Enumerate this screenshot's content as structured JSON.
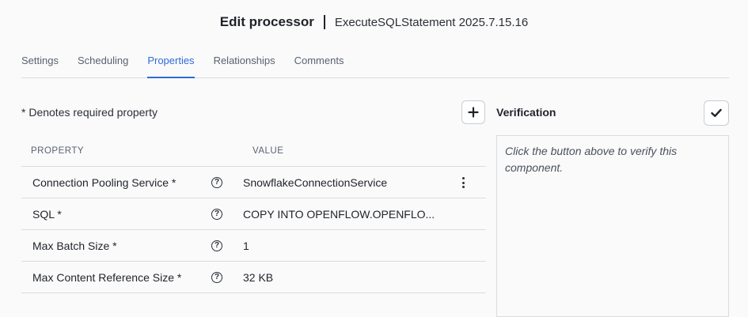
{
  "header": {
    "title": "Edit processor",
    "subtitle": "ExecuteSQLStatement 2025.7.15.16"
  },
  "tabs": [
    {
      "label": "Settings",
      "active": false
    },
    {
      "label": "Scheduling",
      "active": false
    },
    {
      "label": "Properties",
      "active": true
    },
    {
      "label": "Relationships",
      "active": false
    },
    {
      "label": "Comments",
      "active": false
    }
  ],
  "properties": {
    "required_note": "* Denotes required property",
    "columns": {
      "property": "PROPERTY",
      "value": "VALUE"
    },
    "rows": [
      {
        "name": "Connection Pooling Service *",
        "value": "SnowflakeConnectionService",
        "has_menu": true
      },
      {
        "name": "SQL *",
        "value": "COPY INTO OPENFLOW.OPENFLO..."
      },
      {
        "name": "Max Batch Size *",
        "value": "1"
      },
      {
        "name": "Max Content Reference Size *",
        "value": "32 KB"
      }
    ]
  },
  "verification": {
    "title": "Verification",
    "placeholder": "Click the button above to verify this component."
  },
  "icons": {
    "add": "plus-icon",
    "verify": "check-icon",
    "help": "help-circle-icon",
    "menu": "kebab-menu-icon"
  },
  "colors": {
    "accent": "#2f6bd6",
    "border": "#d9dce1",
    "background": "#fafafb"
  }
}
